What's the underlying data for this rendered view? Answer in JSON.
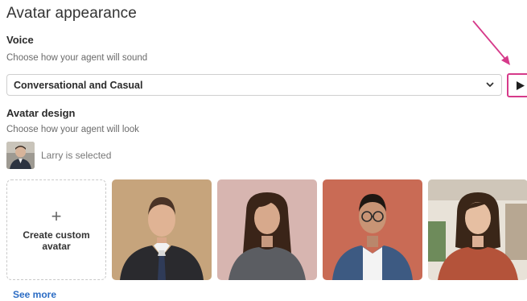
{
  "page_title": "Avatar appearance",
  "voice": {
    "title": "Voice",
    "subtitle": "Choose how your agent will sound",
    "selected": "Conversational and Casual"
  },
  "avatar_design": {
    "title": "Avatar design",
    "subtitle": "Choose how your agent will look",
    "selected_text": "Larry is selected",
    "create_label": "Create custom avatar",
    "see_more": "See more"
  },
  "colors": {
    "highlight": "#d63a8a",
    "link": "#2b6cc4"
  },
  "icons": [
    "chevron-down-icon",
    "play-icon",
    "plus-icon",
    "pointer-arrow-icon"
  ]
}
